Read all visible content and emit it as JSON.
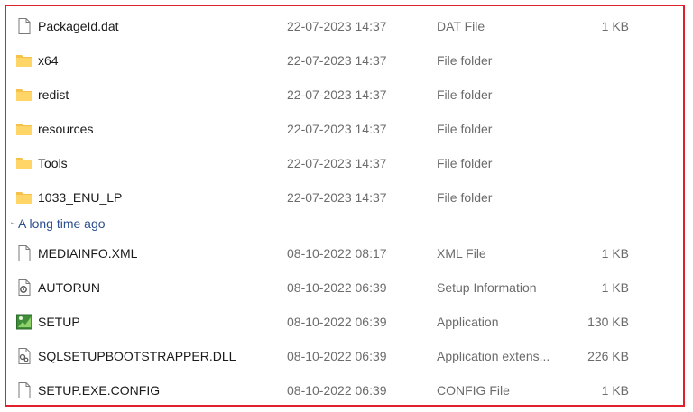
{
  "files_recent": [
    {
      "name": "PackageId.dat",
      "date": "22-07-2023 14:37",
      "type": "DAT File",
      "size": "1 KB",
      "icon": "file-icon"
    },
    {
      "name": "x64",
      "date": "22-07-2023 14:37",
      "type": "File folder",
      "size": "",
      "icon": "folder-icon"
    },
    {
      "name": "redist",
      "date": "22-07-2023 14:37",
      "type": "File folder",
      "size": "",
      "icon": "folder-icon"
    },
    {
      "name": "resources",
      "date": "22-07-2023 14:37",
      "type": "File folder",
      "size": "",
      "icon": "folder-icon"
    },
    {
      "name": "Tools",
      "date": "22-07-2023 14:37",
      "type": "File folder",
      "size": "",
      "icon": "folder-icon"
    },
    {
      "name": "1033_ENU_LP",
      "date": "22-07-2023 14:37",
      "type": "File folder",
      "size": "",
      "icon": "folder-icon"
    }
  ],
  "group_header": "A long time ago",
  "files_old": [
    {
      "name": "MEDIAINFO.XML",
      "date": "08-10-2022 08:17",
      "type": "XML File",
      "size": "1 KB",
      "icon": "file-icon"
    },
    {
      "name": "AUTORUN",
      "date": "08-10-2022 06:39",
      "type": "Setup Information",
      "size": "1 KB",
      "icon": "setup-info-icon"
    },
    {
      "name": "SETUP",
      "date": "08-10-2022 06:39",
      "type": "Application",
      "size": "130 KB",
      "icon": "application-icon"
    },
    {
      "name": "SQLSETUPBOOTSTRAPPER.DLL",
      "date": "08-10-2022 06:39",
      "type": "Application extens...",
      "size": "226 KB",
      "icon": "dll-icon"
    },
    {
      "name": "SETUP.EXE.CONFIG",
      "date": "08-10-2022 06:39",
      "type": "CONFIG File",
      "size": "1 KB",
      "icon": "file-icon"
    }
  ],
  "colors": {
    "frame_border": "#e0212d",
    "folder": "#f4c14b",
    "group_header": "#2b4f8f"
  }
}
